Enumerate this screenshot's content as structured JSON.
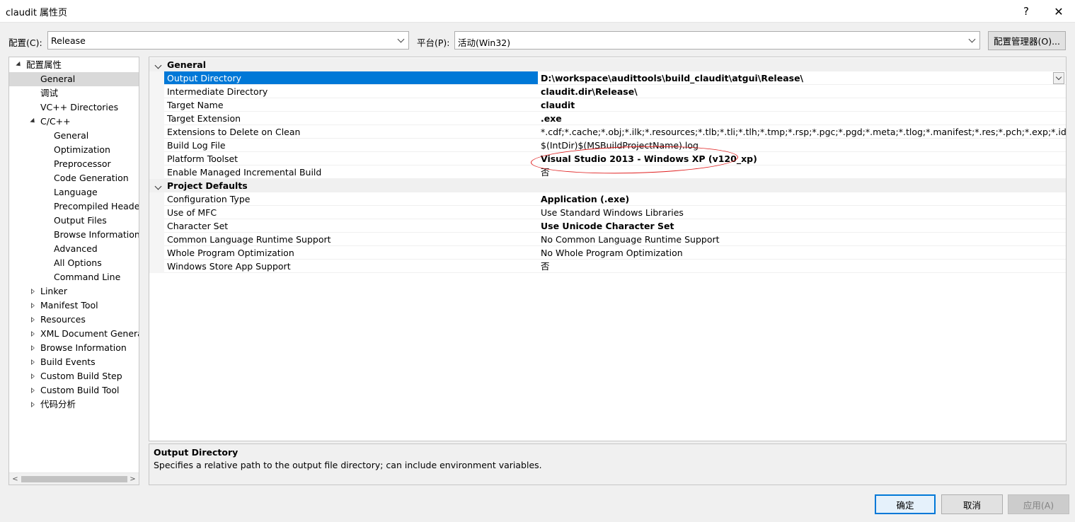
{
  "window": {
    "title": "claudit 属性页",
    "help_glyph": "?",
    "close_glyph": "✕"
  },
  "config": {
    "config_label": "配置(C):",
    "config_value": "Release",
    "platform_label": "平台(P):",
    "platform_value": "活动(Win32)",
    "manager_button": "配置管理器(O)..."
  },
  "tree": {
    "items": [
      {
        "label": "配置属性",
        "level": 0,
        "expander": "expanded"
      },
      {
        "label": "General",
        "level": 1,
        "expander": "none",
        "selected": true
      },
      {
        "label": "调试",
        "level": 1,
        "expander": "none"
      },
      {
        "label": "VC++ Directories",
        "level": 1,
        "expander": "none"
      },
      {
        "label": "C/C++",
        "level": 1,
        "expander": "expanded"
      },
      {
        "label": "General",
        "level": 2,
        "expander": "none"
      },
      {
        "label": "Optimization",
        "level": 2,
        "expander": "none"
      },
      {
        "label": "Preprocessor",
        "level": 2,
        "expander": "none"
      },
      {
        "label": "Code Generation",
        "level": 2,
        "expander": "none"
      },
      {
        "label": "Language",
        "level": 2,
        "expander": "none"
      },
      {
        "label": "Precompiled Header",
        "level": 2,
        "expander": "none"
      },
      {
        "label": "Output Files",
        "level": 2,
        "expander": "none"
      },
      {
        "label": "Browse Information",
        "level": 2,
        "expander": "none"
      },
      {
        "label": "Advanced",
        "level": 2,
        "expander": "none"
      },
      {
        "label": "All Options",
        "level": 2,
        "expander": "none"
      },
      {
        "label": "Command Line",
        "level": 2,
        "expander": "none"
      },
      {
        "label": "Linker",
        "level": 1,
        "expander": "collapsed"
      },
      {
        "label": "Manifest Tool",
        "level": 1,
        "expander": "collapsed"
      },
      {
        "label": "Resources",
        "level": 1,
        "expander": "collapsed"
      },
      {
        "label": "XML Document Generator",
        "level": 1,
        "expander": "collapsed"
      },
      {
        "label": "Browse Information",
        "level": 1,
        "expander": "collapsed"
      },
      {
        "label": "Build Events",
        "level": 1,
        "expander": "collapsed"
      },
      {
        "label": "Custom Build Step",
        "level": 1,
        "expander": "collapsed"
      },
      {
        "label": "Custom Build Tool",
        "level": 1,
        "expander": "collapsed"
      },
      {
        "label": "代码分析",
        "level": 1,
        "expander": "collapsed"
      }
    ],
    "scroll_left_glyph": "<",
    "scroll_right_glyph": ">"
  },
  "grid": {
    "rows": [
      {
        "kind": "category",
        "name": "General"
      },
      {
        "kind": "prop",
        "name": "Output Directory",
        "value": "D:\\workspace\\audittools\\build_claudit\\atgui\\Release\\",
        "bold": true,
        "selected": true
      },
      {
        "kind": "prop",
        "name": "Intermediate Directory",
        "value": "claudit.dir\\Release\\",
        "bold": true
      },
      {
        "kind": "prop",
        "name": "Target Name",
        "value": "claudit",
        "bold": true
      },
      {
        "kind": "prop",
        "name": "Target Extension",
        "value": ".exe",
        "bold": true
      },
      {
        "kind": "prop",
        "name": "Extensions to Delete on Clean",
        "value": "*.cdf;*.cache;*.obj;*.ilk;*.resources;*.tlb;*.tli;*.tlh;*.tmp;*.rsp;*.pgc;*.pgd;*.meta;*.tlog;*.manifest;*.res;*.pch;*.exp;*.idb;*.rep;*.xdc;*.pdb",
        "bold": false
      },
      {
        "kind": "prop",
        "name": "Build Log File",
        "value": "$(IntDir)$(MSBuildProjectName).log",
        "bold": false
      },
      {
        "kind": "prop",
        "name": "Platform Toolset",
        "value": "Visual Studio 2013 - Windows XP (v120_xp)",
        "bold": true
      },
      {
        "kind": "prop",
        "name": "Enable Managed Incremental Build",
        "value": "否",
        "bold": false
      },
      {
        "kind": "category",
        "name": "Project Defaults"
      },
      {
        "kind": "prop",
        "name": "Configuration Type",
        "value": "Application (.exe)",
        "bold": true
      },
      {
        "kind": "prop",
        "name": "Use of MFC",
        "value": "Use Standard Windows Libraries",
        "bold": false
      },
      {
        "kind": "prop",
        "name": "Character Set",
        "value": "Use Unicode Character Set",
        "bold": true
      },
      {
        "kind": "prop",
        "name": "Common Language Runtime Support",
        "value": "No Common Language Runtime Support",
        "bold": false
      },
      {
        "kind": "prop",
        "name": "Whole Program Optimization",
        "value": "No Whole Program Optimization",
        "bold": false
      },
      {
        "kind": "prop",
        "name": "Windows Store App Support",
        "value": "否",
        "bold": false
      }
    ]
  },
  "description": {
    "title": "Output Directory",
    "text": "Specifies a relative path to the output file directory; can include environment variables."
  },
  "buttons": {
    "ok": "确定",
    "cancel": "取消",
    "apply": "应用(A)"
  },
  "colors": {
    "selection": "#0078d7",
    "annotation": "#e02020"
  }
}
